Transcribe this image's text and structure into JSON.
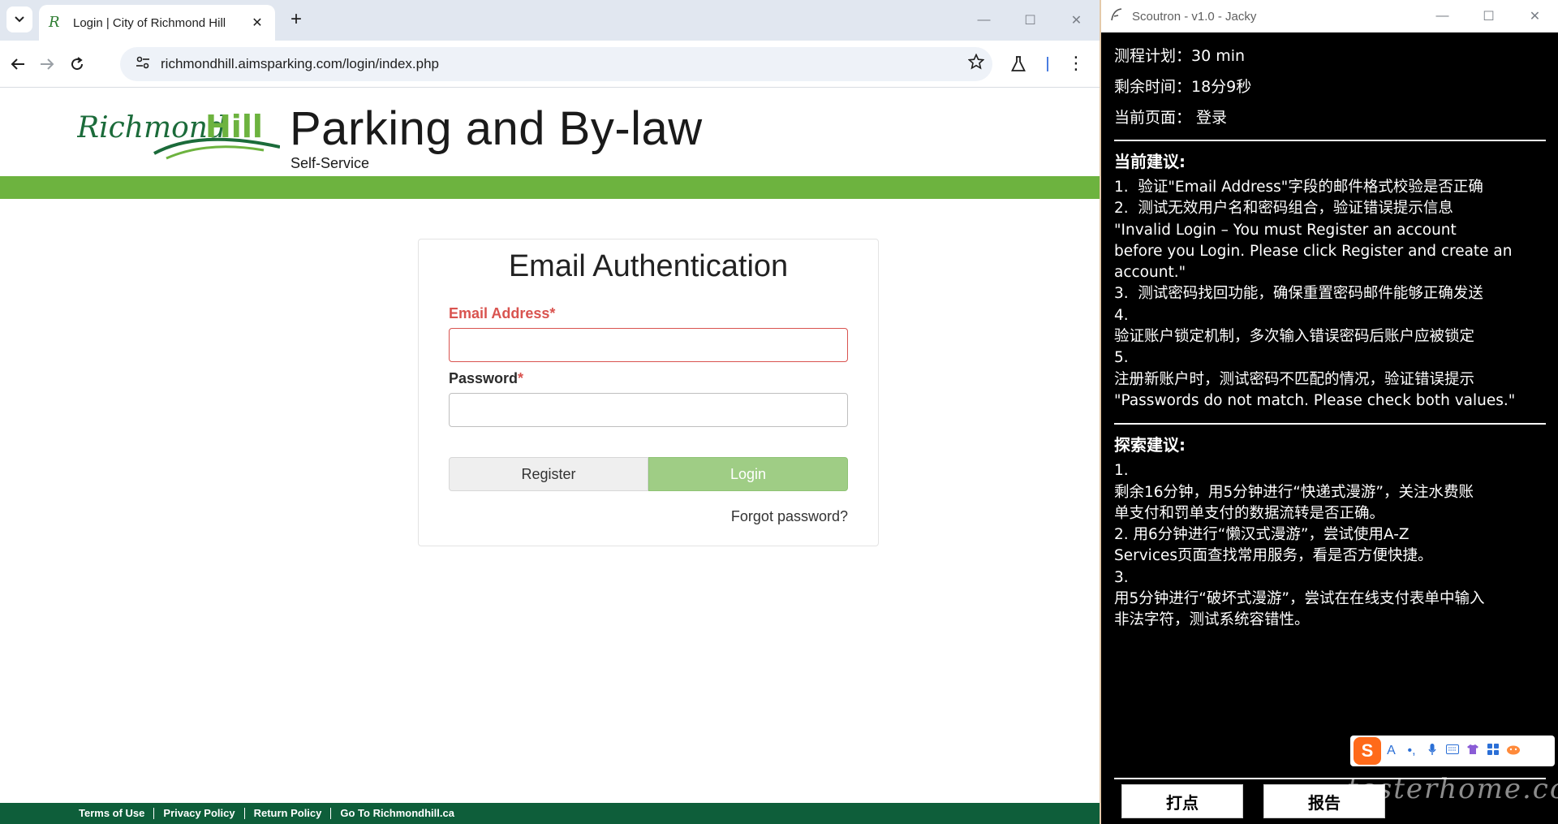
{
  "browser": {
    "tab_search_icon": "chevron-down-icon",
    "tab": {
      "title": "Login | City of Richmond Hill",
      "close": "✕"
    },
    "new_tab": "+",
    "url": "richmondhill.aimsparking.com/login/index.php",
    "window_controls": {
      "minimize": "—",
      "maximize": "☐",
      "close": "✕"
    }
  },
  "site": {
    "logo_text": "Richmond Hill",
    "title": "Parking and By-law",
    "subtitle": "Self-Service",
    "brand_green": "#6db33f"
  },
  "login": {
    "heading": "Email Authentication",
    "email_label": "Email Address",
    "password_label": "Password",
    "required_mark": "*",
    "email_value": "",
    "password_value": "",
    "register_label": "Register",
    "login_label": "Login",
    "forgot_label": "Forgot password?"
  },
  "footer": {
    "links": [
      "Terms of Use",
      "Privacy Policy",
      "Return Policy",
      "Go To Richmondhill.ca"
    ]
  },
  "scoutron": {
    "window_title": "Scoutron - v1.0 - Jacky",
    "plan": "测程计划：30 min",
    "remaining": "剩余时间：18分9秒",
    "current_page": "当前页面： 登录",
    "current_suggestions_title": "当前建议:",
    "current_suggestions": "1.  验证\"Email Address\"字段的邮件格式校验是否正确\n2.  测试无效用户名和密码组合，验证错误提示信息\n\"Invalid Login – You must Register an account\nbefore you Login. Please click Register and create an\naccount.\"\n3.  测试密码找回功能，确保重置密码邮件能够正确发送\n4.\n验证账户锁定机制，多次输入错误密码后账户应被锁定\n5.\n注册新账户时，测试密码不匹配的情况，验证错误提示\n\"Passwords do not match. Please check both values.\"",
    "explore_title": "探索建议:",
    "explore_suggestions": "1.\n剩余16分钟，用5分钟进行“快递式漫游”，关注水费账\n单支付和罚单支付的数据流转是否正确。\n2. 用6分钟进行“懒汉式漫游”，尝试使用A-Z\nServices页面查找常用服务，看是否方便快捷。\n3.\n用5分钟进行“破坏式漫游”，尝试在在线支付表单中输入\n非法字符，测试系统容错性。",
    "mark_button": "打点",
    "report_button": "报告"
  },
  "ime": {
    "logo": "S",
    "mode": "A"
  },
  "watermark": "testerhome.com"
}
